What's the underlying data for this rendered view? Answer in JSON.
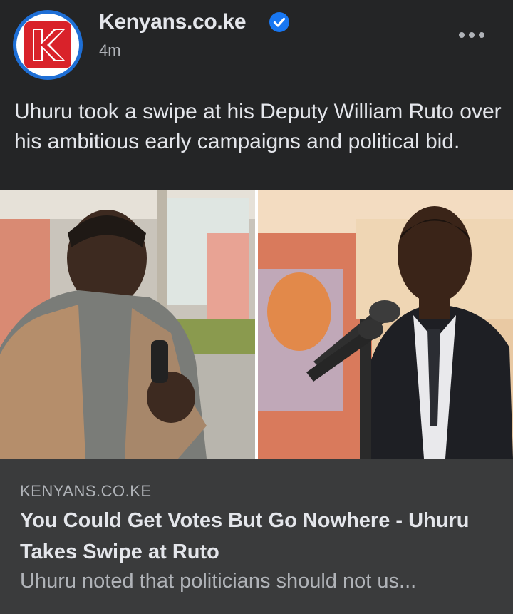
{
  "post": {
    "page_name": "Kenyans.co.ke",
    "timestamp": "4m",
    "caption": "Uhuru took a swipe at his Deputy William Ruto over his ambitious early campaigns and political bid.",
    "more_icon": "more-horizontal-icon",
    "verified_icon": "verified-badge-icon",
    "avatar_logo": "K"
  },
  "link_preview": {
    "domain": "KENYANS.CO.KE",
    "headline": "You Could Get Votes But Go Nowhere - Uhuru Takes Swipe at Ruto",
    "snippet": "Uhuru noted that politicians should not us..."
  },
  "colors": {
    "post_bg": "#242526",
    "card_bg": "#3a3b3c",
    "primary_text": "#e4e6eb",
    "secondary_text": "#b0b3b8",
    "verified_blue": "#1877f2",
    "brand_red": "#d9222a"
  }
}
